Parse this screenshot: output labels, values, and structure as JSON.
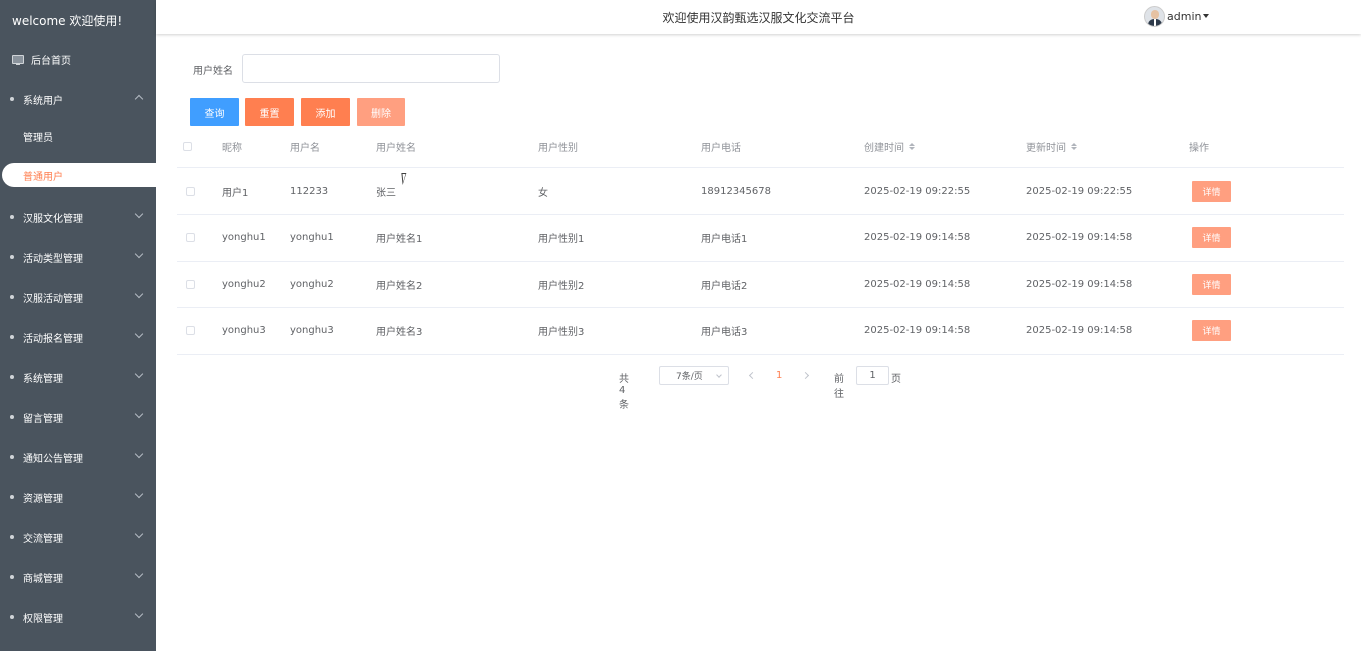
{
  "sidebar": {
    "brand": "welcome 欢迎使用!",
    "home": "后台首页",
    "system_users": {
      "label": "系统用户",
      "children": [
        "管理员",
        "普通用户"
      ]
    },
    "menu": [
      "汉服文化管理",
      "活动类型管理",
      "汉服活动管理",
      "活动报名管理",
      "系统管理",
      "留言管理",
      "通知公告管理",
      "资源管理",
      "交流管理",
      "商城管理",
      "权限管理"
    ]
  },
  "header": {
    "title": "欢迎使用汉韵甄选汉服文化交流平台",
    "username": "admin"
  },
  "search": {
    "label": "用户姓名",
    "value": "",
    "placeholder": ""
  },
  "toolbar": {
    "query": "查询",
    "reset": "重置",
    "add": "添加",
    "delete": "删除"
  },
  "table": {
    "columns": [
      "昵称",
      "用户名",
      "用户姓名",
      "用户性别",
      "用户电话",
      "创建时间",
      "更新时间",
      "操作"
    ],
    "rows": [
      [
        "用户1",
        "112233",
        "张三",
        "女",
        "18912345678",
        "2025-02-19 09:22:55",
        "2025-02-19 09:22:55"
      ],
      [
        "yonghu1",
        "yonghu1",
        "用户姓名1",
        "用户性别1",
        "用户电话1",
        "2025-02-19 09:14:58",
        "2025-02-19 09:14:58"
      ],
      [
        "yonghu2",
        "yonghu2",
        "用户姓名2",
        "用户性别2",
        "用户电话2",
        "2025-02-19 09:14:58",
        "2025-02-19 09:14:58"
      ],
      [
        "yonghu3",
        "yonghu3",
        "用户姓名3",
        "用户性别3",
        "用户电话3",
        "2025-02-19 09:14:58",
        "2025-02-19 09:14:58"
      ]
    ],
    "action_label": "详情"
  },
  "pagination": {
    "total": "共 4 条",
    "page_size": "7条/页",
    "current_page": "1",
    "goto_label": "前往",
    "goto_value": "1",
    "page_unit": "页"
  },
  "colors": {
    "sidebar_bg": "#4a545e",
    "accent": "#ff7f50",
    "primary": "#409eff"
  }
}
